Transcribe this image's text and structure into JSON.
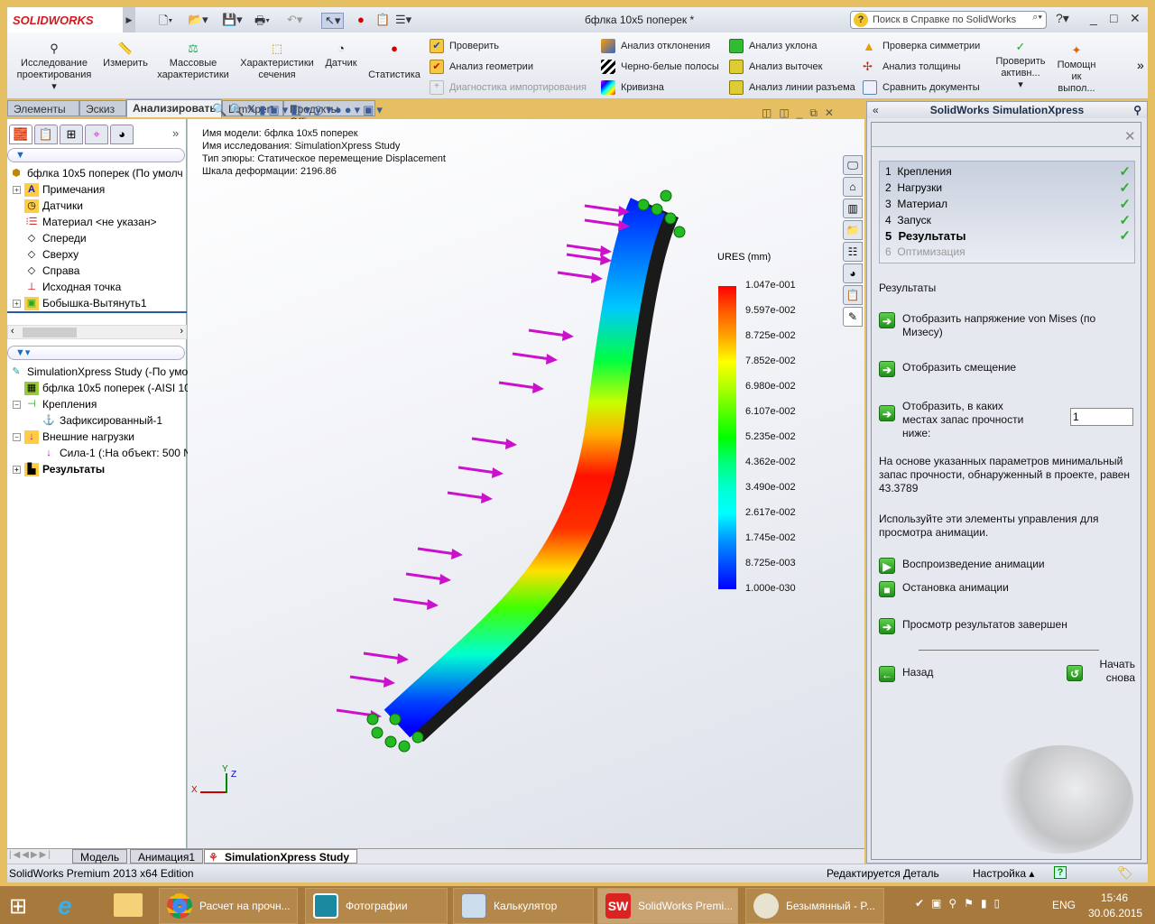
{
  "app": {
    "brand": "SOLIDWORKS",
    "doc_title": "бфлка 10x5 поперек *",
    "help_search_placeholder": "Поиск в Справке по SolidWorks",
    "help_icon": "?"
  },
  "ribbon": {
    "big": [
      {
        "label": "Исследование проектирования",
        "icon": "design-study-icon"
      },
      {
        "label": "Измерить",
        "icon": "measure-icon"
      },
      {
        "label": "Массовые характеристики",
        "icon": "mass-properties-icon"
      },
      {
        "label": "Характеристики сечения",
        "icon": "section-properties-icon"
      },
      {
        "label": "Датчик",
        "icon": "sensor-icon"
      },
      {
        "label": "Статистика",
        "icon": "statistics-icon"
      }
    ],
    "col1": [
      "Проверить",
      "Анализ геометрии",
      "Диагностика импортирования"
    ],
    "col2": [
      "Анализ отклонения",
      "Черно-белые полосы",
      "Кривизна"
    ],
    "col3": [
      "Анализ уклона",
      "Анализ выточек",
      "Анализ линии разъема"
    ],
    "col4": [
      "Проверка симметрии",
      "Анализ толщины",
      "Сравнить документы"
    ],
    "check_active": "Проверить активн...",
    "assistant": "Помощн ик выпол...",
    "more": "»"
  },
  "command_tabs": [
    "Элементы",
    "Эскиз",
    "Анализировать",
    "DimXpert",
    "Продукты Office"
  ],
  "active_command_tab": "Анализировать",
  "feature_tree": {
    "root": "бфлка 10x5 поперек  (По умолч",
    "items": [
      "Примечания",
      "Датчики",
      "Материал <не указан>",
      "Спереди",
      "Сверху",
      "Справа",
      "Исходная точка",
      "Бобышка-Вытянуть1"
    ],
    "more": "»"
  },
  "sim_tree": {
    "root": "SimulationXpress Study (-По умо",
    "items": [
      "бфлка 10x5 поперек (-AISI 10",
      "Крепления",
      "Зафиксированный-1",
      "Внешние нагрузки",
      "Сила-1 (:На объект: 500 N",
      "Результаты"
    ]
  },
  "viewport": {
    "info": [
      "Имя модели: бфлка 10x5 поперек",
      "Имя  исследования: SimulationXpress Study",
      "Тип эпюры: Статическое перемещение Displacement",
      "Шкала деформации: 2196.86"
    ],
    "legend_title": "URES (mm)",
    "legend_values": [
      "1.047e-001",
      "9.597e-002",
      "8.725e-002",
      "7.852e-002",
      "6.980e-002",
      "6.107e-002",
      "5.235e-002",
      "4.362e-002",
      "3.490e-002",
      "2.617e-002",
      "1.745e-002",
      "8.725e-003",
      "1.000e-030"
    ],
    "legend_colors": [
      "#ff0000",
      "#ff5a00",
      "#ffa500",
      "#ffff00",
      "#b0ff00",
      "#55ff00",
      "#00ff00",
      "#00ff7a",
      "#00ffd0",
      "#00ffff",
      "#0099ff",
      "#004dff",
      "#0000ff"
    ],
    "load_color": "#cc11cc",
    "fixture_color": "#22bb22",
    "axes": [
      "X",
      "Y",
      "Z"
    ]
  },
  "task_pane": {
    "title": "SolidWorks SimulationXpress",
    "steps": [
      {
        "num": "1",
        "label": "Крепления",
        "done": true
      },
      {
        "num": "2",
        "label": "Нагрузки",
        "done": true
      },
      {
        "num": "3",
        "label": "Материал",
        "done": true
      },
      {
        "num": "4",
        "label": "Запуск",
        "done": true
      },
      {
        "num": "5",
        "label": "Результаты",
        "done": true
      },
      {
        "num": "6",
        "label": "Оптимизация",
        "done": false
      }
    ],
    "section": "Результаты",
    "show_von_mises": "Отобразить напряжение von Mises (по Мизесу)",
    "show_displacement": "Отобразить смещение",
    "show_fos": "Отобразить, в каких местах запас прочности ниже:",
    "fos_value": "1",
    "summary": "На основе указанных параметров минимальный запас прочности, обнаруженный в проекте, равен 43.3789",
    "anim_hint": "Используйте эти элементы управления для просмотра анимации.",
    "play": "Воспроизведение анимации",
    "stop": "Остановка анимации",
    "done": "Просмотр результатов завершен",
    "back": "Назад",
    "restart": "Начать снова"
  },
  "bottom_tabs": [
    "Модель",
    "Анимация1",
    "SimulationXpress Study"
  ],
  "status": {
    "edition": "SolidWorks Premium 2013 x64 Edition",
    "editing": "Редактируется Деталь",
    "settings": "Настройка"
  },
  "taskbar": {
    "apps": [
      "Расчет на прочн...",
      "Фотографии",
      "Калькулятор",
      "SolidWorks Premi...",
      "Безымянный - P..."
    ],
    "lang": "ENG",
    "time": "15:46",
    "date": "30.06.2015"
  }
}
